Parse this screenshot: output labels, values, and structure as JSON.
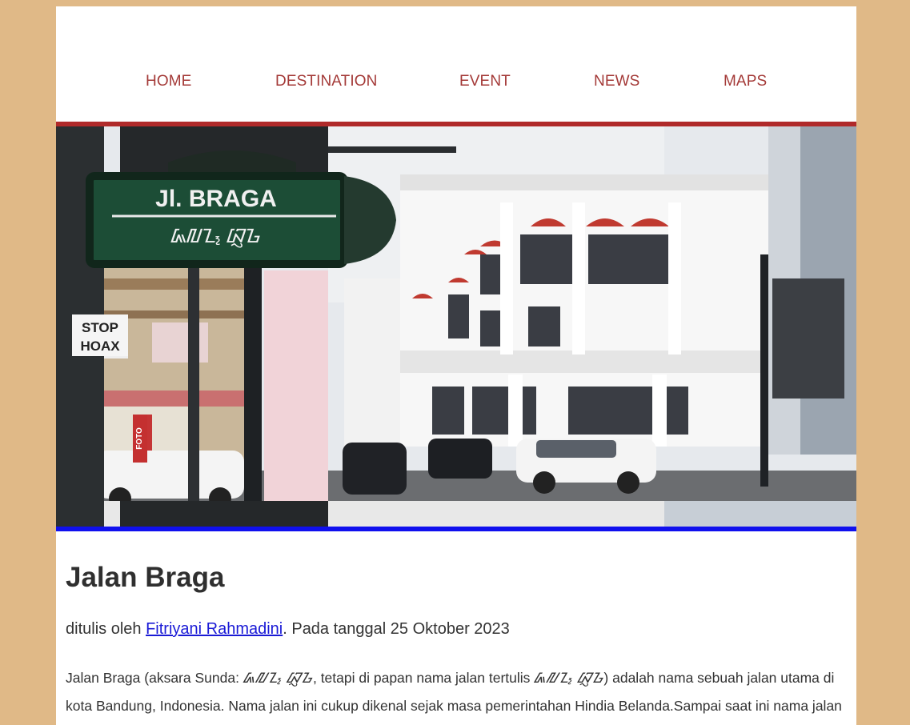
{
  "nav": {
    "items": [
      {
        "label": "HOME"
      },
      {
        "label": "DESTINATION"
      },
      {
        "label": "EVENT"
      },
      {
        "label": "NEWS"
      },
      {
        "label": "MAPS"
      }
    ]
  },
  "hero": {
    "sign_line1": "Jl. BRAGA",
    "sign_line2": "ᮏᮜᮔ᮪ ᮘᮢᮌ",
    "shop_sign1": "STOP",
    "shop_sign2": "HOAX",
    "shop_sign3": "FOTO"
  },
  "article": {
    "title": "Jalan Braga",
    "byline_prefix": "ditulis oleh ",
    "author": "Fitriyani Rahmadini",
    "byline_suffix": ". Pada tanggal 25 Oktober 2023",
    "para_part1": "Jalan Braga (aksara Sunda: ",
    "sunda1": "ᮏᮜᮔ᮪ ᮘᮢᮌ",
    "para_part2": ", tetapi di papan nama jalan tertulis ",
    "sunda2": "ᮏᮜᮔ᮪ ᮘᮢᮌ",
    "para_part3": ") adalah nama sebuah jalan utama di kota Bandung, Indonesia. Nama jalan ini cukup dikenal sejak masa pemerintahan Hindia Belanda.Sampai saat ini nama jalan"
  },
  "colors": {
    "page_bg": "#e0b987",
    "nav_text": "#a43a38",
    "top_bar": "#b02a2a",
    "bottom_bar": "#1010ee",
    "link": "#1a1ad6"
  }
}
